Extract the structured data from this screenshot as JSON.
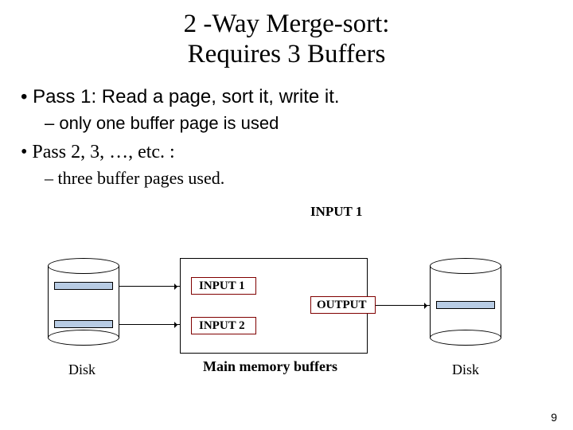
{
  "title_line1": "2 -Way Merge-sort:",
  "title_line2": "Requires 3 Buffers",
  "bullets": {
    "pass1": "Pass 1: Read a page, sort it, write it.",
    "pass1_sub": "only one buffer page is used",
    "pass2": "Pass 2, 3, …, etc. :",
    "pass2_sub": " three buffer pages used."
  },
  "diagram": {
    "float_label": "INPUT 1",
    "input1": "INPUT 1",
    "input2": "INPUT 2",
    "output": "OUTPUT",
    "mem_caption": "Main memory buffers",
    "disk_left": "Disk",
    "disk_right": "Disk"
  },
  "page_number": "9"
}
